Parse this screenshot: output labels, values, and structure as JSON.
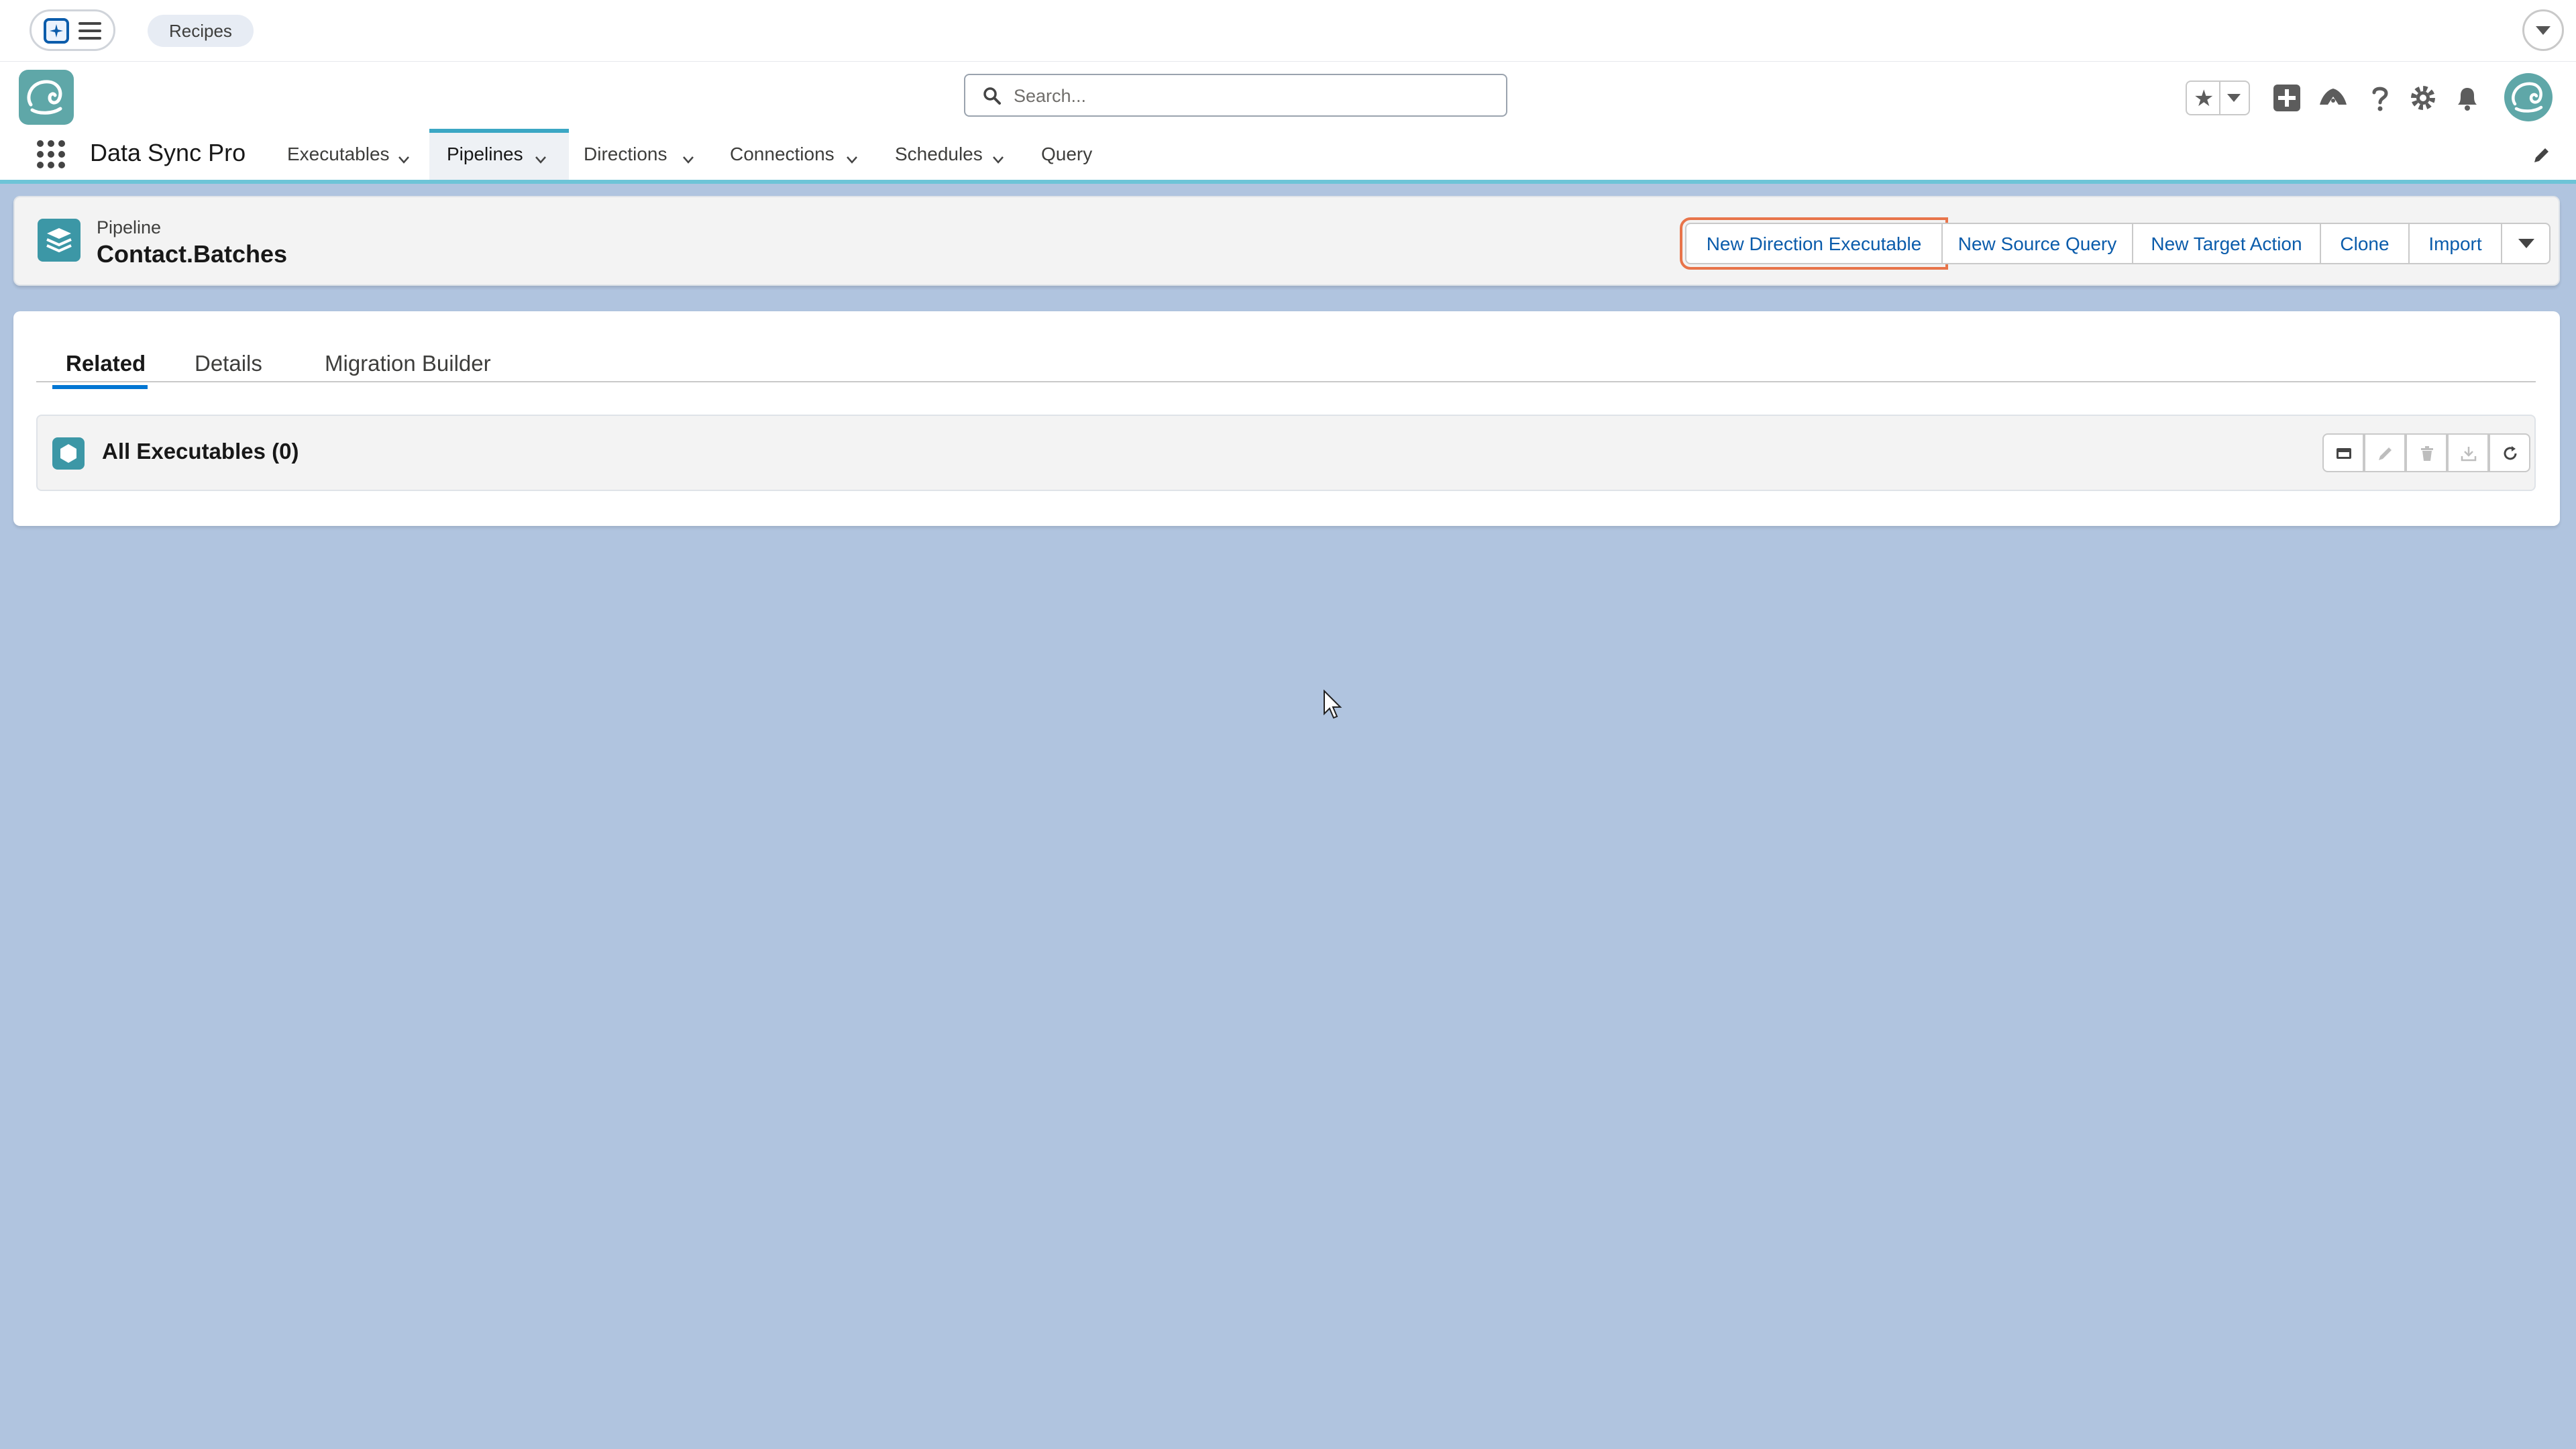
{
  "topbar": {
    "chip_label": "Recipes"
  },
  "header": {
    "search_placeholder": "Search...",
    "icons": [
      "favorites-star-icon",
      "global-add-icon",
      "trailhead-icon",
      "help-icon",
      "setup-gear-icon",
      "notifications-bell-icon"
    ]
  },
  "nav": {
    "app_name": "Data Sync Pro",
    "items": [
      {
        "label": "Executables",
        "has_menu": true,
        "active": false
      },
      {
        "label": "Pipelines",
        "has_menu": true,
        "active": true
      },
      {
        "label": "Directions",
        "has_menu": true,
        "active": false
      },
      {
        "label": "Connections",
        "has_menu": true,
        "active": false
      },
      {
        "label": "Schedules",
        "has_menu": true,
        "active": false
      },
      {
        "label": "Query",
        "has_menu": false,
        "active": false
      }
    ]
  },
  "record": {
    "object_type": "Pipeline",
    "title": "Contact.Batches",
    "actions": [
      "New Direction Executable",
      "New Source Query",
      "New Target Action",
      "Clone",
      "Import"
    ],
    "focused_action": "New Direction Executable"
  },
  "tabs": [
    {
      "label": "Related",
      "active": true
    },
    {
      "label": "Details",
      "active": false
    },
    {
      "label": "Migration Builder",
      "active": false
    }
  ],
  "related_list": {
    "title": "All Executables (0)",
    "action_icons": [
      "display-icon",
      "edit-icon",
      "delete-icon",
      "download-icon",
      "refresh-icon"
    ]
  },
  "colors": {
    "background": "#b0c4df",
    "brand_accent": "#0176d3",
    "focus_ring": "#e8744a",
    "icon_teal": "#3c97a6"
  }
}
